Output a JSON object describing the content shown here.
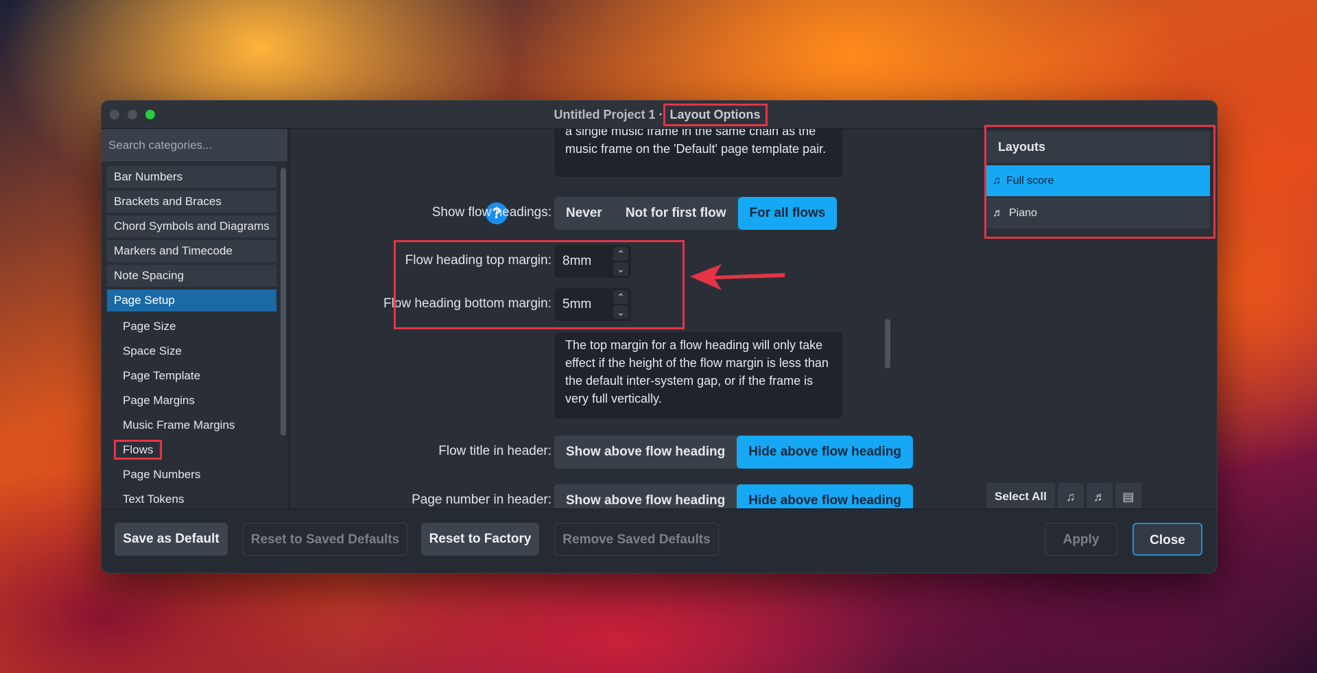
{
  "window": {
    "title_prefix": "Untitled Project 1 · ",
    "title_main": "Layout Options"
  },
  "sidebar": {
    "search_placeholder": "Search categories...",
    "categories": [
      {
        "label": "Bar Numbers"
      },
      {
        "label": "Brackets and Braces"
      },
      {
        "label": "Chord Symbols and Diagrams"
      },
      {
        "label": "Markers and Timecode"
      },
      {
        "label": "Note Spacing"
      },
      {
        "label": "Page Setup"
      }
    ],
    "subitems": [
      {
        "label": "Page Size"
      },
      {
        "label": "Space Size"
      },
      {
        "label": "Page Template"
      },
      {
        "label": "Page Margins"
      },
      {
        "label": "Music Frame Margins"
      },
      {
        "label": "Flows"
      },
      {
        "label": "Page Numbers"
      },
      {
        "label": "Text Tokens"
      }
    ]
  },
  "main": {
    "top_tip": "a single music frame in the same chain as the music frame on the 'Default' page template pair.",
    "show_flow_headings": {
      "label": "Show flow headings:",
      "options": [
        "Never",
        "Not for first flow",
        "For all flows"
      ],
      "selected": "For all flows"
    },
    "top_margin": {
      "label": "Flow heading top margin:",
      "value": "8mm"
    },
    "bottom_margin": {
      "label": "Flow heading bottom margin:",
      "value": "5mm"
    },
    "margin_tip": "The top margin for a flow heading will only take effect if the height of the flow margin is less than the default inter-system gap, or if the frame is very full vertically.",
    "flow_title_header": {
      "label": "Flow title in header:",
      "options": [
        "Show above flow heading",
        "Hide above flow heading"
      ],
      "selected": "Hide above flow heading"
    },
    "page_number_header": {
      "label": "Page number in header:",
      "options": [
        "Show above flow heading",
        "Hide above flow heading"
      ],
      "selected": "Hide above flow heading"
    }
  },
  "layouts": {
    "title": "Layouts",
    "items": [
      {
        "label": "Full score",
        "selected": true
      },
      {
        "label": "Piano",
        "selected": false
      }
    ],
    "select_all": "Select All"
  },
  "buttons": {
    "save_default": "Save as Default",
    "reset_saved": "Reset to Saved Defaults",
    "reset_factory": "Reset to Factory",
    "remove_saved": "Remove Saved Defaults",
    "apply": "Apply",
    "close": "Close"
  },
  "colors": {
    "accent": "#17a8f5",
    "selection": "#1b6aa6",
    "annotation": "#e63446"
  }
}
